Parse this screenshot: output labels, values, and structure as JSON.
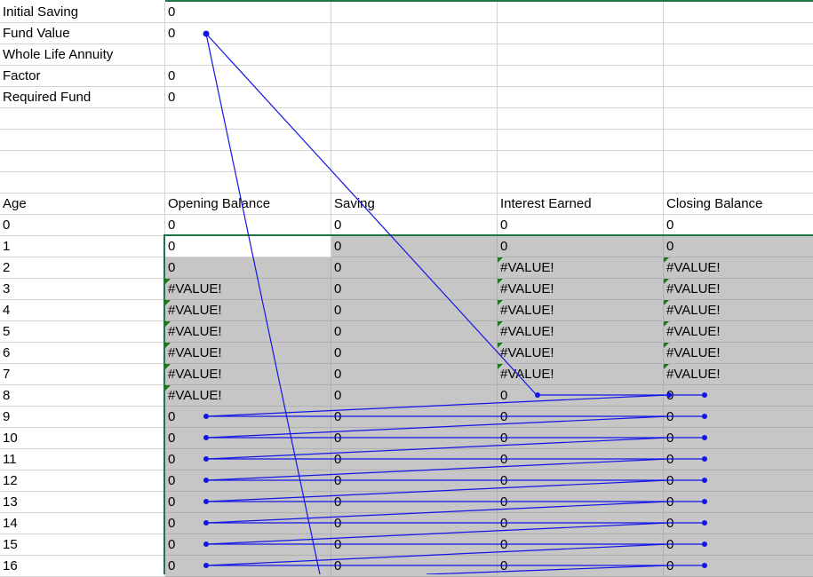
{
  "params": [
    {
      "label": "Initial Saving",
      "value": "0"
    },
    {
      "label": "Fund Value",
      "value": "0"
    },
    {
      "label": "Whole Life Annuity",
      "value": ""
    },
    {
      "label": "Factor",
      "value": "0"
    },
    {
      "label": "Required Fund",
      "value": "0"
    }
  ],
  "table": {
    "headers": [
      "Age",
      "Opening Balance",
      "Saving",
      "Interest Earned",
      "Closing Balance"
    ],
    "rows": [
      [
        "0",
        "0",
        "0",
        "0",
        "0"
      ],
      [
        "1",
        "0",
        "0",
        "0",
        "0"
      ],
      [
        "2",
        "0",
        "0",
        "#VALUE!",
        "#VALUE!"
      ],
      [
        "3",
        "#VALUE!",
        "0",
        "#VALUE!",
        "#VALUE!"
      ],
      [
        "4",
        "#VALUE!",
        "0",
        "#VALUE!",
        "#VALUE!"
      ],
      [
        "5",
        "#VALUE!",
        "0",
        "#VALUE!",
        "#VALUE!"
      ],
      [
        "6",
        "#VALUE!",
        "0",
        "#VALUE!",
        "#VALUE!"
      ],
      [
        "7",
        "#VALUE!",
        "0",
        "#VALUE!",
        "#VALUE!"
      ],
      [
        "8",
        "#VALUE!",
        "0",
        "0",
        "0"
      ],
      [
        "9",
        "0",
        "0",
        "0",
        "0"
      ],
      [
        "10",
        "0",
        "0",
        "0",
        "0"
      ],
      [
        "11",
        "0",
        "0",
        "0",
        "0"
      ],
      [
        "12",
        "0",
        "0",
        "0",
        "0"
      ],
      [
        "13",
        "0",
        "0",
        "0",
        "0"
      ],
      [
        "14",
        "0",
        "0",
        "0",
        "0"
      ],
      [
        "15",
        "0",
        "0",
        "0",
        "0"
      ],
      [
        "16",
        "0",
        "0",
        "0",
        "0"
      ]
    ]
  },
  "colors": {
    "trace_arrow": "#1414e6",
    "selection_border": "#217346",
    "selected_range_fill": "#c6c6c6",
    "error_indicator": "#1a7a1a",
    "gridline": "#d4d4d4"
  }
}
